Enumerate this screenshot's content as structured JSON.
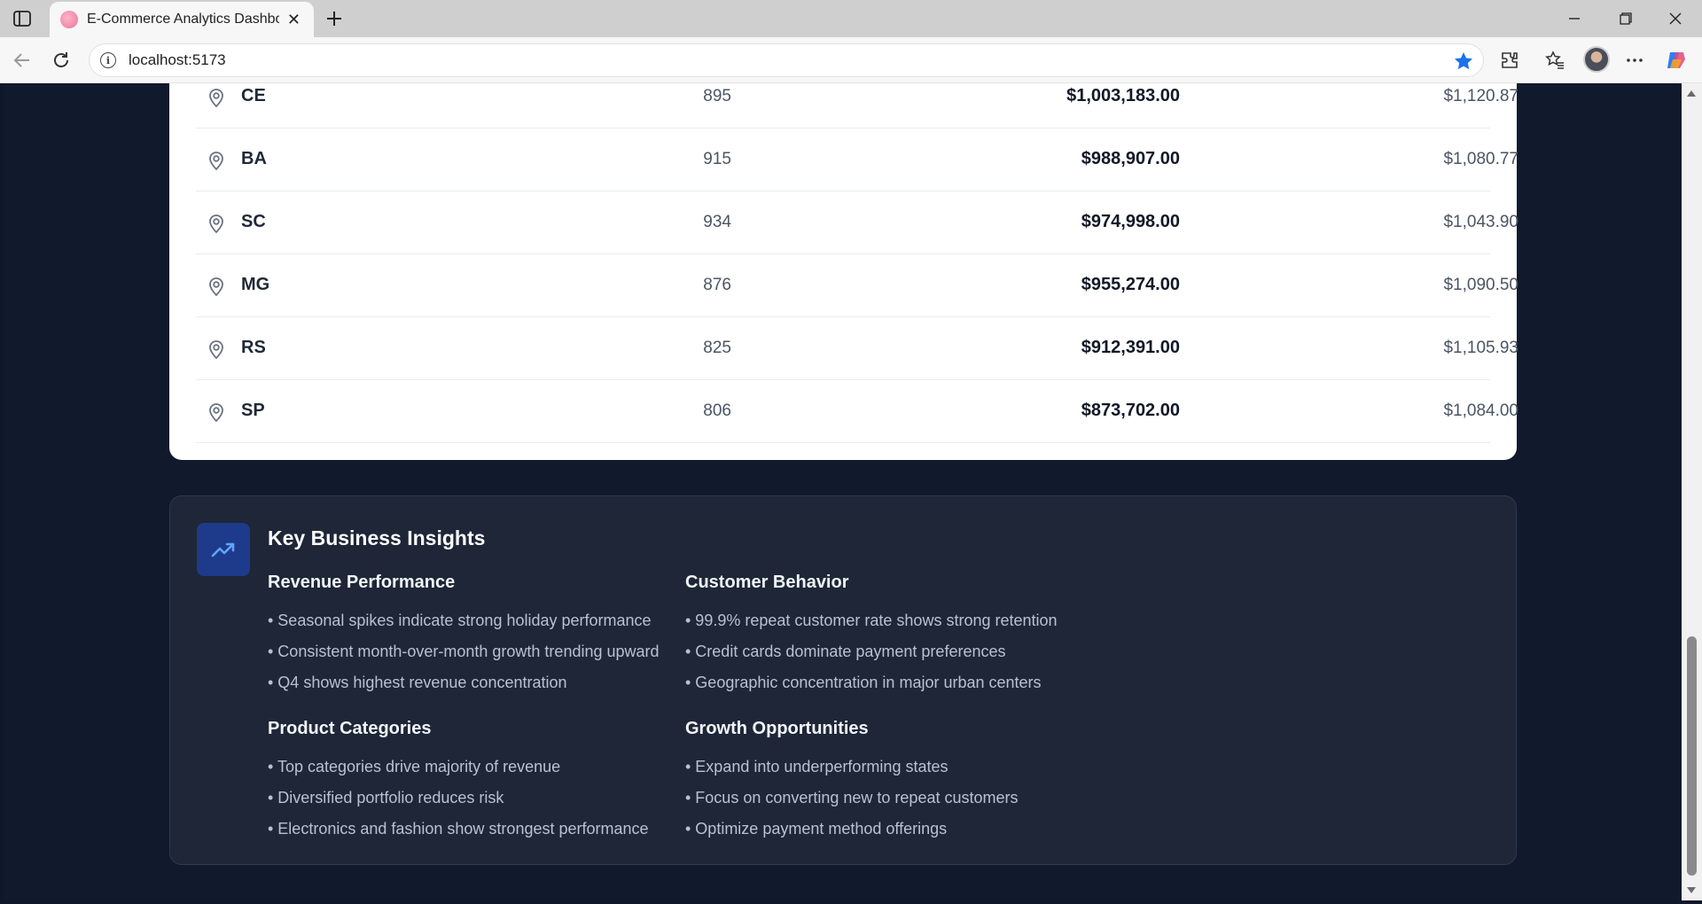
{
  "browser": {
    "tab_title": "E-Commerce Analytics Dashboard",
    "url": "localhost:5173"
  },
  "table": {
    "rows": [
      {
        "state": "CE",
        "customers": "895",
        "revenue": "$1,003,183.00",
        "avg_order": "$1,120.87"
      },
      {
        "state": "BA",
        "customers": "915",
        "revenue": "$988,907.00",
        "avg_order": "$1,080.77"
      },
      {
        "state": "SC",
        "customers": "934",
        "revenue": "$974,998.00",
        "avg_order": "$1,043.90"
      },
      {
        "state": "MG",
        "customers": "876",
        "revenue": "$955,274.00",
        "avg_order": "$1,090.50"
      },
      {
        "state": "RS",
        "customers": "825",
        "revenue": "$912,391.00",
        "avg_order": "$1,105.93"
      },
      {
        "state": "SP",
        "customers": "806",
        "revenue": "$873,702.00",
        "avg_order": "$1,084.00"
      }
    ]
  },
  "insights": {
    "title": "Key Business Insights",
    "sections": [
      {
        "title": "Revenue Performance",
        "items": [
          "• Seasonal spikes indicate strong holiday performance",
          "• Consistent month-over-month growth trending upward",
          "• Q4 shows highest revenue concentration"
        ]
      },
      {
        "title": "Customer Behavior",
        "items": [
          "• 99.9% repeat customer rate shows strong retention",
          "• Credit cards dominate payment preferences",
          "• Geographic concentration in major urban centers"
        ]
      },
      {
        "title": "Product Categories",
        "items": [
          "• Top categories drive majority of revenue",
          "• Diversified portfolio reduces risk",
          "• Electronics and fashion show strongest performance"
        ]
      },
      {
        "title": "Growth Opportunities",
        "items": [
          "• Expand into underperforming states",
          "• Focus on converting new to repeat customers",
          "• Optimize payment method offerings"
        ]
      }
    ]
  },
  "colors": {
    "page_bg": "#111a2c",
    "card_bg": "#ffffff",
    "insights_bg": "#1e2637",
    "accent": "#1e3a8a",
    "bookmark_star": "#1a73e8"
  }
}
